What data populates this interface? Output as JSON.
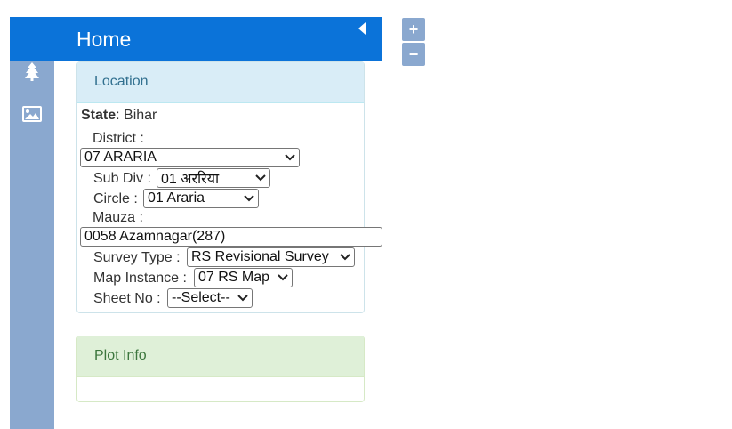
{
  "header": {
    "title": "Home"
  },
  "sidebar": {
    "icons": [
      "menu-icon",
      "tree-icon",
      "image-icon"
    ]
  },
  "map_controls": {
    "zoom_in": "+",
    "zoom_out": "−"
  },
  "location_panel": {
    "title": "Location",
    "state_label": "State",
    "state_value": ": Bihar",
    "district_label": "District :",
    "district_value": "07 ARARIA",
    "subdiv_label": "Sub Div :",
    "subdiv_value": "01 अररिया",
    "circle_label": "Circle :",
    "circle_value": "01 Araria",
    "mauza_label": "Mauza :",
    "mauza_value": "0058 Azamnagar(287)",
    "survey_type_label": "Survey Type :",
    "survey_type_value": "RS Revisional Survey",
    "map_instance_label": "Map Instance :",
    "map_instance_value": "07 RS Map",
    "sheet_no_label": "Sheet No :",
    "sheet_no_value": "--Select--"
  },
  "plot_panel": {
    "title": "Plot Info"
  }
}
